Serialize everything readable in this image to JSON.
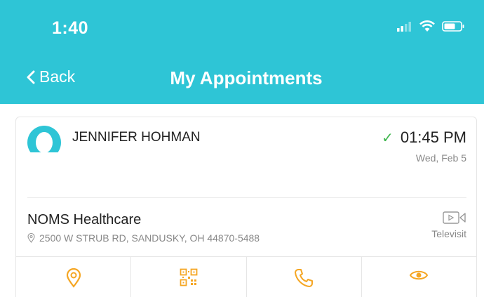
{
  "status_bar": {
    "time": "1:40",
    "icons": [
      "signal-icon",
      "wifi-icon",
      "battery-icon"
    ]
  },
  "nav": {
    "back_label": "Back",
    "title": "My Appointments"
  },
  "appointment": {
    "patient_name": "JENNIFER HOHMAN",
    "time": "01:45 PM",
    "date": "Wed, Feb 5",
    "confirmed": true,
    "facility": "NOMS Healthcare",
    "address": "2500 W STRUB RD, SANDUSKY, OH 44870-5488",
    "visit_type": "Televisit",
    "actions": [
      "location-icon",
      "qr-code-icon",
      "phone-icon",
      "eye-icon"
    ]
  },
  "colors": {
    "header": "#2ec5d6",
    "accent": "#f5a623",
    "check": "#3bb54a"
  }
}
